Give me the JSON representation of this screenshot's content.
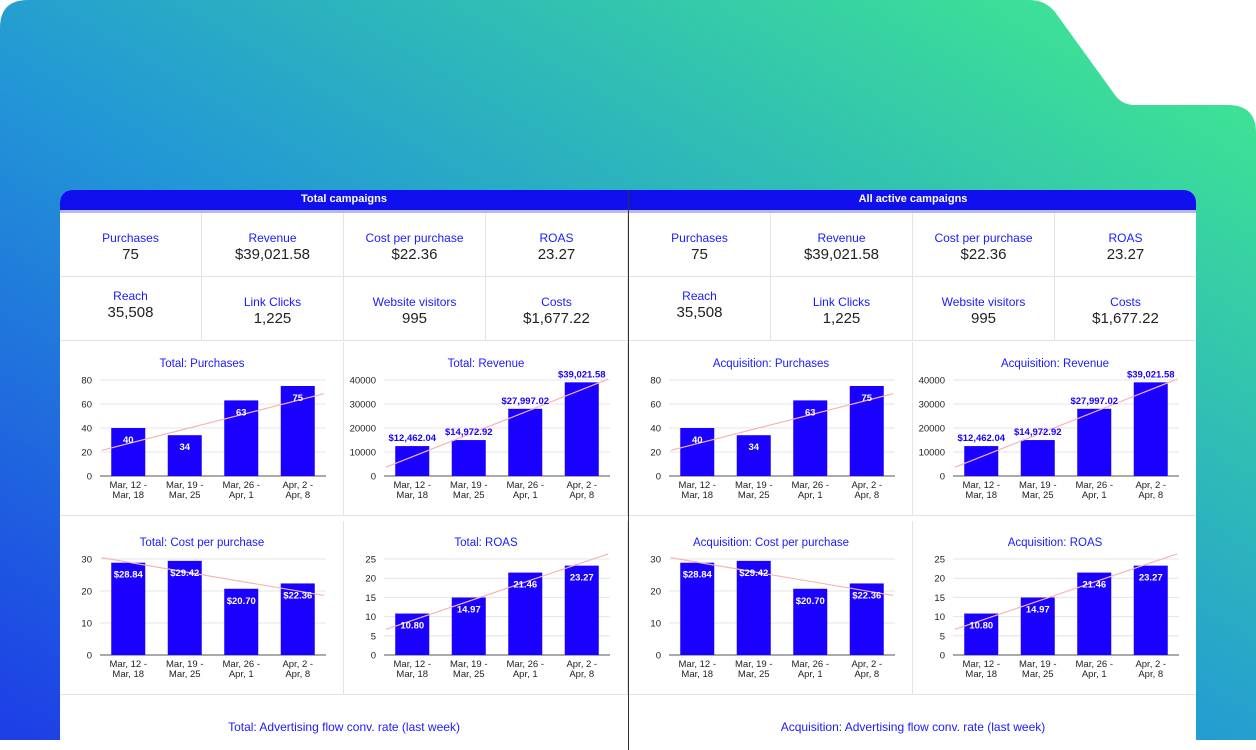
{
  "colors": {
    "accent": "#1010ee",
    "bar": "#1a00ff",
    "title_text": "#1a1aff",
    "trend": "#f5b5b5",
    "bg_gradient": [
      "#1f47e8",
      "#25b7c8",
      "#3fe98f"
    ]
  },
  "panels": [
    {
      "header": "Total campaigns",
      "kpis": [
        {
          "label": "Purchases",
          "value": "75"
        },
        {
          "label": "Revenue",
          "value": "$39,021.58"
        },
        {
          "label": "Cost per purchase",
          "value": "$22.36"
        },
        {
          "label": "ROAS",
          "value": "23.27"
        },
        {
          "label": "Reach",
          "value": "35,508"
        },
        {
          "label": "Link Clicks",
          "value": "1,225"
        },
        {
          "label": "Website visitors",
          "value": "995"
        },
        {
          "label": "Costs",
          "value": "$1,677.22"
        }
      ],
      "bottom_title": "Total: Advertising flow conv. rate (last week)"
    },
    {
      "header": "All active campaigns",
      "kpis": [
        {
          "label": "Purchases",
          "value": "75"
        },
        {
          "label": "Revenue",
          "value": "$39,021.58"
        },
        {
          "label": "Cost per purchase",
          "value": "$22.36"
        },
        {
          "label": "ROAS",
          "value": "23.27"
        },
        {
          "label": "Reach",
          "value": "35,508"
        },
        {
          "label": "Link Clicks",
          "value": "1,225"
        },
        {
          "label": "Website visitors",
          "value": "995"
        },
        {
          "label": "Costs",
          "value": "$1,677.22"
        }
      ],
      "bottom_title": "Acquisition: Advertising flow conv. rate (last week)"
    }
  ],
  "chart_data": [
    {
      "type": "bar",
      "title": "Total: Purchases",
      "categories": [
        [
          "Mar, 12 -",
          "Mar, 18"
        ],
        [
          "Mar, 19 -",
          "Mar, 25"
        ],
        [
          "Mar, 26 -",
          "Apr, 1"
        ],
        [
          "Apr, 2 -",
          "Apr, 8"
        ]
      ],
      "values": [
        40,
        34,
        63,
        75
      ],
      "labels": [
        "40",
        "34",
        "63",
        "75"
      ],
      "ylim": [
        0,
        80
      ],
      "yticks": [
        "0",
        "20",
        "40",
        "60",
        "80"
      ],
      "trend": [
        27,
        39,
        51,
        63
      ]
    },
    {
      "type": "bar",
      "title": "Total: Revenue",
      "categories": [
        [
          "Mar, 12 -",
          "Mar, 18"
        ],
        [
          "Mar, 19 -",
          "Mar, 25"
        ],
        [
          "Mar, 26 -",
          "Apr, 1"
        ],
        [
          "Apr, 2 -",
          "Apr, 8"
        ]
      ],
      "values": [
        12462.04,
        14972.92,
        27997.02,
        39021.58
      ],
      "labels": [
        "$12,462.04",
        "$14,972.92",
        "$27,997.02",
        "$39,021.58"
      ],
      "ylim": [
        0,
        40000
      ],
      "yticks": [
        "0",
        "10000",
        "20000",
        "30000",
        "40000"
      ],
      "trend": [
        8000,
        17000,
        26500,
        36000
      ]
    },
    {
      "type": "bar",
      "title": "Total: Cost per purchase",
      "categories": [
        [
          "Mar, 12 -",
          "Mar, 18"
        ],
        [
          "Mar, 19 -",
          "Mar, 25"
        ],
        [
          "Mar, 26 -",
          "Apr, 1"
        ],
        [
          "Apr, 2 -",
          "Apr, 8"
        ]
      ],
      "values": [
        28.84,
        29.42,
        20.7,
        22.36
      ],
      "labels": [
        "$28.84",
        "$29.42",
        "$20.70",
        "$22.36"
      ],
      "ylim": [
        0,
        30
      ],
      "yticks": [
        "0",
        "10",
        "20",
        "30"
      ],
      "trend": [
        29,
        26.5,
        23,
        20
      ]
    },
    {
      "type": "bar",
      "title": "Total: ROAS",
      "categories": [
        [
          "Mar, 12 -",
          "Mar, 18"
        ],
        [
          "Mar, 19 -",
          "Mar, 25"
        ],
        [
          "Mar, 26 -",
          "Apr, 1"
        ],
        [
          "Apr, 2 -",
          "Apr, 8"
        ]
      ],
      "values": [
        10.8,
        14.97,
        21.46,
        23.27
      ],
      "labels": [
        "10.80",
        "14.97",
        "21.46",
        "23.27"
      ],
      "ylim": [
        0,
        25
      ],
      "yticks": [
        "0",
        "5",
        "10",
        "15",
        "20",
        "25"
      ],
      "trend": [
        9,
        14,
        19,
        24
      ]
    },
    {
      "type": "bar",
      "title": "Acquisition: Purchases",
      "categories": [
        [
          "Mar, 12 -",
          "Mar, 18"
        ],
        [
          "Mar, 19 -",
          "Mar, 25"
        ],
        [
          "Mar, 26 -",
          "Apr, 1"
        ],
        [
          "Apr, 2 -",
          "Apr, 8"
        ]
      ],
      "values": [
        40,
        34,
        63,
        75
      ],
      "labels": [
        "40",
        "34",
        "63",
        "75"
      ],
      "ylim": [
        0,
        80
      ],
      "yticks": [
        "0",
        "20",
        "40",
        "60",
        "80"
      ],
      "trend": [
        27,
        39,
        51,
        63
      ]
    },
    {
      "type": "bar",
      "title": "Acquisition: Revenue",
      "categories": [
        [
          "Mar, 12 -",
          "Mar, 18"
        ],
        [
          "Mar, 19 -",
          "Mar, 25"
        ],
        [
          "Mar, 26 -",
          "Apr, 1"
        ],
        [
          "Apr, 2 -",
          "Apr, 8"
        ]
      ],
      "values": [
        12462.04,
        14972.92,
        27997.02,
        39021.58
      ],
      "labels": [
        "$12,462.04",
        "$14,972.92",
        "$27,997.02",
        "$39,021.58"
      ],
      "ylim": [
        0,
        40000
      ],
      "yticks": [
        "0",
        "10000",
        "20000",
        "30000",
        "40000"
      ],
      "trend": [
        8000,
        17000,
        26500,
        36000
      ]
    },
    {
      "type": "bar",
      "title": "Acquisition: Cost per purchase",
      "categories": [
        [
          "Mar, 12 -",
          "Mar, 18"
        ],
        [
          "Mar, 19 -",
          "Mar, 25"
        ],
        [
          "Mar, 26 -",
          "Apr, 1"
        ],
        [
          "Apr, 2 -",
          "Apr, 8"
        ]
      ],
      "values": [
        28.84,
        29.42,
        20.7,
        22.36
      ],
      "labels": [
        "$28.84",
        "$29.42",
        "$20.70",
        "$22.36"
      ],
      "ylim": [
        0,
        30
      ],
      "yticks": [
        "0",
        "10",
        "20",
        "30"
      ],
      "trend": [
        29,
        26.5,
        23,
        20
      ]
    },
    {
      "type": "bar",
      "title": "Acquisition: ROAS",
      "categories": [
        [
          "Mar, 12 -",
          "Mar, 18"
        ],
        [
          "Mar, 19 -",
          "Mar, 25"
        ],
        [
          "Mar, 26 -",
          "Apr, 1"
        ],
        [
          "Apr, 2 -",
          "Apr, 8"
        ]
      ],
      "values": [
        10.8,
        14.97,
        21.46,
        23.27
      ],
      "labels": [
        "10.80",
        "14.97",
        "21.46",
        "23.27"
      ],
      "ylim": [
        0,
        25
      ],
      "yticks": [
        "0",
        "5",
        "10",
        "15",
        "20",
        "25"
      ],
      "trend": [
        9,
        14,
        19,
        24
      ]
    }
  ]
}
